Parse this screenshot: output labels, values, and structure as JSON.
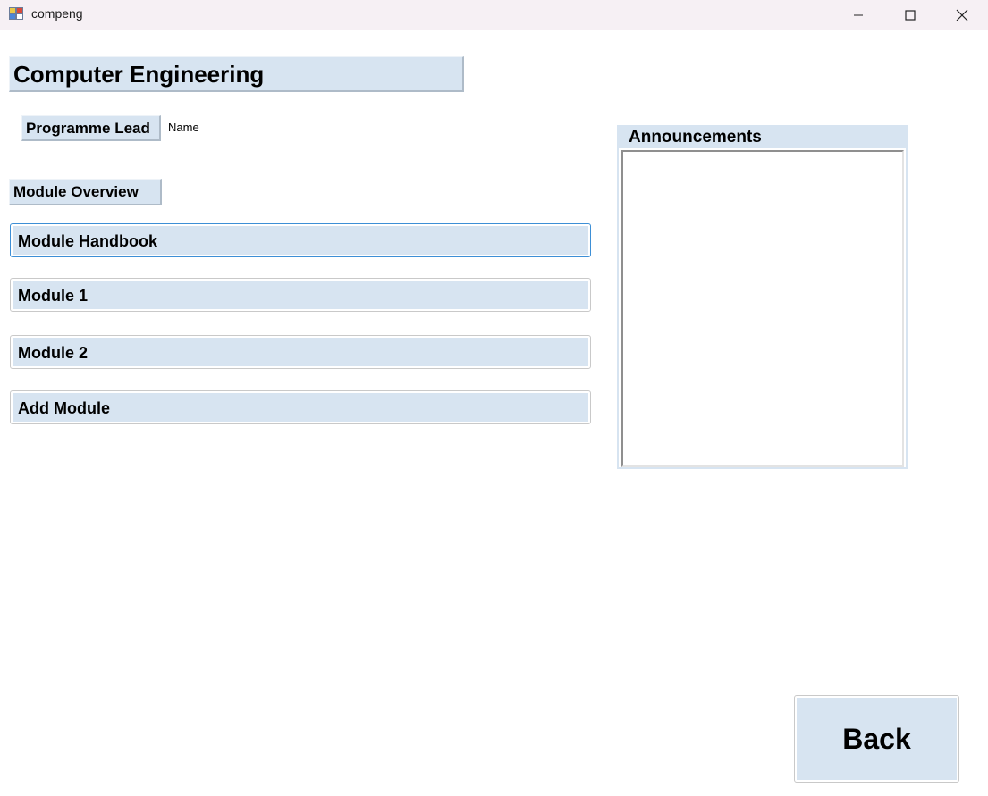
{
  "window": {
    "title": "compeng",
    "controls": [
      "minimize",
      "maximize",
      "close"
    ]
  },
  "form": {
    "page_title": "Computer Engineering",
    "programme_lead_label": "Programme Lead",
    "programme_lead_name": "Name",
    "module_overview_label": "Module Overview",
    "module_buttons": [
      "Module Handbook",
      "Module 1",
      "Module 2",
      "Add Module"
    ],
    "announcements_title": "Announcements",
    "announcements_text": "",
    "back_label": "Back"
  },
  "colors": {
    "label_background": "#d7e4f1",
    "titlebar_background": "#f6f0f4",
    "focus_border": "#3d8fd6"
  }
}
